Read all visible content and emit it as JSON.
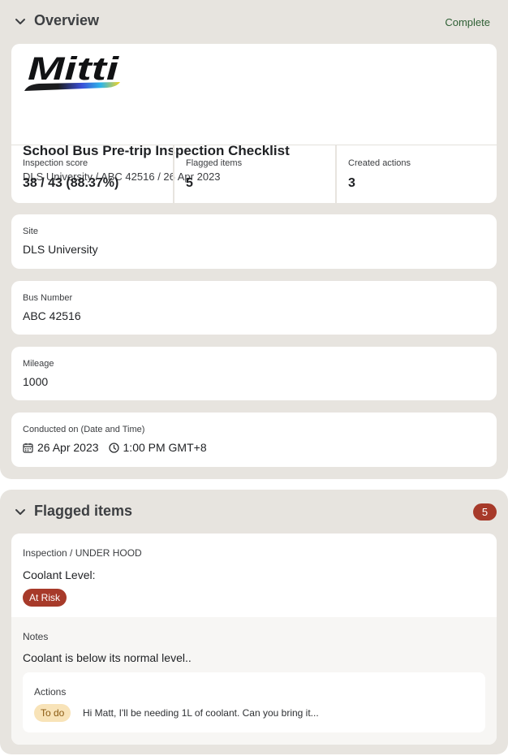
{
  "overview": {
    "title": "Overview",
    "status": "Complete",
    "chevron_icon": "chevron-down-icon",
    "logo_text": "Mitti",
    "report_title": "School Bus Pre-trip Inspection Checklist",
    "report_subtitle": "DLS University / ABC 42516 / 26 Apr 2023",
    "stats": [
      {
        "label": "Inspection score",
        "value": "38 / 43 (88.37%)"
      },
      {
        "label": "Flagged items",
        "value": "5"
      },
      {
        "label": "Created actions",
        "value": "3"
      }
    ],
    "fields": {
      "site": {
        "label": "Site",
        "value": "DLS University"
      },
      "bus_number": {
        "label": "Bus Number",
        "value": "ABC 42516"
      },
      "mileage": {
        "label": "Mileage",
        "value": "1000"
      },
      "conducted_on": {
        "label": "Conducted on (Date and Time)",
        "date": "26 Apr 2023",
        "time": "1:00 PM GMT+8",
        "date_icon": "calendar-icon",
        "time_icon": "clock-icon"
      }
    }
  },
  "flagged": {
    "title": "Flagged items",
    "count": "5",
    "chevron_icon": "chevron-down-icon",
    "item": {
      "breadcrumb": "Inspection / UNDER HOOD",
      "question": "Coolant Level:",
      "response": "At Risk",
      "notes_label": "Notes",
      "notes": "Coolant is below its normal level..",
      "actions_label": "Actions",
      "action_status": "To do",
      "action_text": "Hi Matt, I'll be needing 1L of coolant. Can you bring it..."
    }
  },
  "colors": {
    "section_bg": "#e7e4df",
    "card_bg": "#ffffff",
    "complete_green": "#2e5f34",
    "risk_red": "#a73a2a",
    "todo_bg": "#f8e3b8",
    "todo_text": "#8a5a12"
  }
}
